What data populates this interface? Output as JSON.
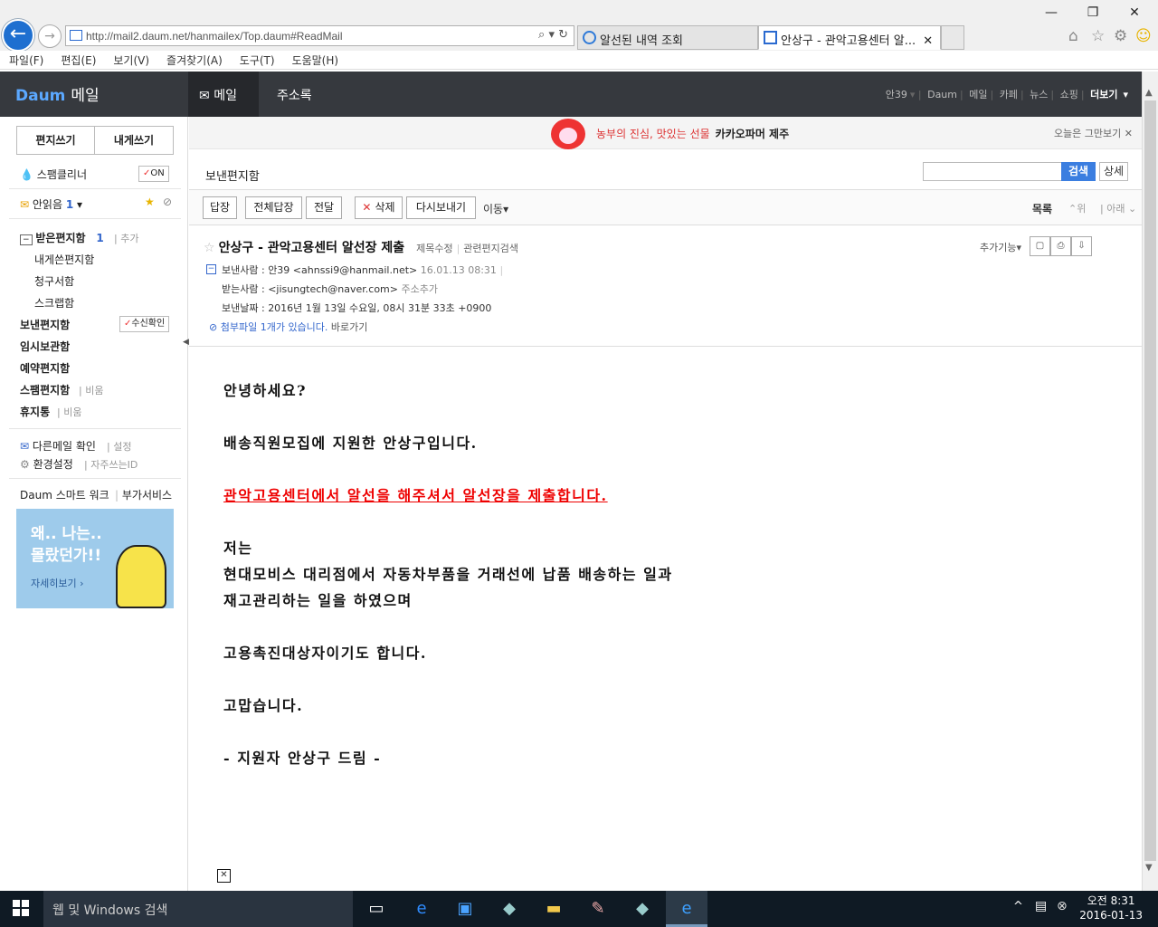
{
  "browser": {
    "url": "http://mail2.daum.net/hanmailex/Top.daum#ReadMail",
    "tabs": [
      {
        "label": "알선된 내역 조회"
      },
      {
        "label": "안상구 - 관악고용센터 알..."
      }
    ],
    "menu": [
      "파일(F)",
      "편집(E)",
      "보기(V)",
      "즐겨찾기(A)",
      "도구(T)",
      "도움말(H)"
    ]
  },
  "header": {
    "logo": "Daum",
    "app": "메일",
    "tabs": [
      {
        "label": "메일"
      },
      {
        "label": "주소록"
      }
    ],
    "nav": [
      "안39",
      "Daum",
      "메일",
      "카페",
      "뉴스",
      "쇼핑",
      "더보기"
    ]
  },
  "sidebar": {
    "compose": "편지쓰기",
    "self": "내게쓰기",
    "spam_cleaner": "스팸클리너",
    "spam_on": "ON",
    "unread_label": "안읽음",
    "unread_count": "1",
    "inbox_label": "받은편지함",
    "inbox_count": "1",
    "inbox_add": "추가",
    "subfolders": [
      "내게쓴편지함",
      "청구서함",
      "스크랩함"
    ],
    "sent": "보낸편지함",
    "receipt": "수신확인",
    "drafts": "임시보관함",
    "scheduled": "예약편지함",
    "spam": "스팸편지함",
    "spam_empty": "비움",
    "trash": "휴지통",
    "trash_empty": "비움",
    "other_mail": "다른메일 확인",
    "other_setting": "설정",
    "settings": "환경설정",
    "frequent_id": "자주쓰는ID",
    "smart_work": "Daum 스마트 워크",
    "addon": "부가서비스",
    "ad": {
      "line1": "왜.. 나는..",
      "line2": "몰랐던가!!",
      "more": "자세히보기"
    }
  },
  "banner": {
    "text_red": "농부의 진심, 맛있는 선물",
    "text_dark": "카카오파머 제주",
    "close": "오늘은 그만보기"
  },
  "folder_title": "보낸편지함",
  "search": {
    "button": "검색",
    "detail": "상세"
  },
  "toolbar": {
    "reply": "답장",
    "reply_all": "전체답장",
    "forward": "전달",
    "delete": "삭제",
    "resend": "다시보내기",
    "move": "이동",
    "list": "목록",
    "up": "위",
    "down": "아래"
  },
  "mail": {
    "subject": "안상구 - 관악고용센터 알선장 제출",
    "edit_subject": "제목수정",
    "related": "관련편지검색",
    "more_functions": "추가기능",
    "from_label": "보낸사람",
    "from": "안39 <ahnssi9@hanmail.net>",
    "from_time": "16.01.13 08:31",
    "to_label": "받는사람",
    "to": "<jisungtech@naver.com>",
    "add_address": "주소추가",
    "date_label": "보낸날짜",
    "date": "2016년 1월 13일 수요일, 08시 31분 33초 +0900",
    "attach_prefix": "첨부파일 ",
    "attach_count": "1",
    "attach_suffix": "개가 있습니다.",
    "attach_go": "바로가기",
    "body": {
      "l1": "안녕하세요?",
      "l2": "배송직원모집에 지원한 안상구입니다.",
      "l3": "관악고용센터에서 알선을 해주셔서 알선장을 제출합니다.",
      "l4": "저는",
      "l5": "현대모비스 대리점에서 자동차부품을 거래선에 납품 배송하는 일과",
      "l6": "재고관리하는 일을 하였으며",
      "l7": "고용촉진대상자이기도 합니다.",
      "l8": "고맙습니다.",
      "l9": "- 지원자 안상구 드림 -"
    }
  },
  "taskbar": {
    "search": "웹 및 Windows 검색",
    "time": "오전 8:31",
    "date": "2016-01-13"
  }
}
